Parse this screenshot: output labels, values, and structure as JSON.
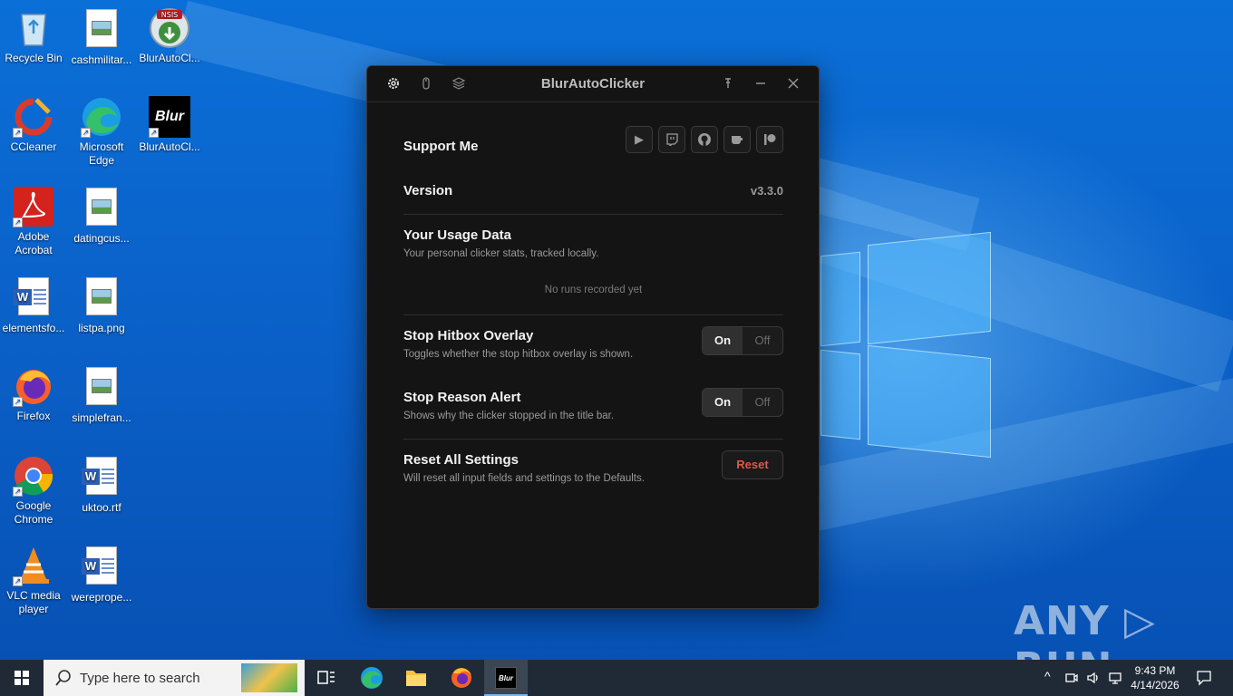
{
  "desktop": {
    "icons": [
      {
        "label": "Recycle Bin"
      },
      {
        "label": "cashmilitar..."
      },
      {
        "label": "BlurAutoCl..."
      },
      {
        "label": "CCleaner"
      },
      {
        "label": "Microsoft Edge"
      },
      {
        "label": "BlurAutoCl..."
      },
      {
        "label": "Adobe Acrobat"
      },
      {
        "label": "datingcus..."
      },
      {
        "label": "elementsfo..."
      },
      {
        "label": "listpa.png"
      },
      {
        "label": "Firefox"
      },
      {
        "label": "simplefran..."
      },
      {
        "label": "Google Chrome"
      },
      {
        "label": "uktoo.rtf"
      },
      {
        "label": "VLC media player"
      },
      {
        "label": "werepropе..."
      }
    ],
    "blur_logo_text": "Blur",
    "nsis_text": "NSIS",
    "watermark": "ANY ▷ RUN"
  },
  "app": {
    "title": "BlurAutoClicker",
    "support": {
      "label": "Support Me"
    },
    "version": {
      "label": "Version",
      "value": "v3.3.0"
    },
    "usage": {
      "title": "Your Usage Data",
      "desc": "Your personal clicker stats, tracked locally.",
      "empty": "No runs recorded yet"
    },
    "hitbox": {
      "title": "Stop Hitbox Overlay",
      "desc": "Toggles whether the stop hitbox overlay is shown.",
      "on": "On",
      "off": "Off"
    },
    "reason": {
      "title": "Stop Reason Alert",
      "desc": "Shows why the clicker stopped in the title bar.",
      "on": "On",
      "off": "Off"
    },
    "reset": {
      "title": "Reset All Settings",
      "desc": "Will reset all input fields and settings to the Defaults.",
      "button": "Reset"
    },
    "colors": {
      "bg": "#141414",
      "reset_red": "#e0584a"
    }
  },
  "taskbar": {
    "search_placeholder": "Type here to search",
    "active_app_label": "Blur",
    "time": "9:43 PM",
    "date": "4/14/2026"
  }
}
